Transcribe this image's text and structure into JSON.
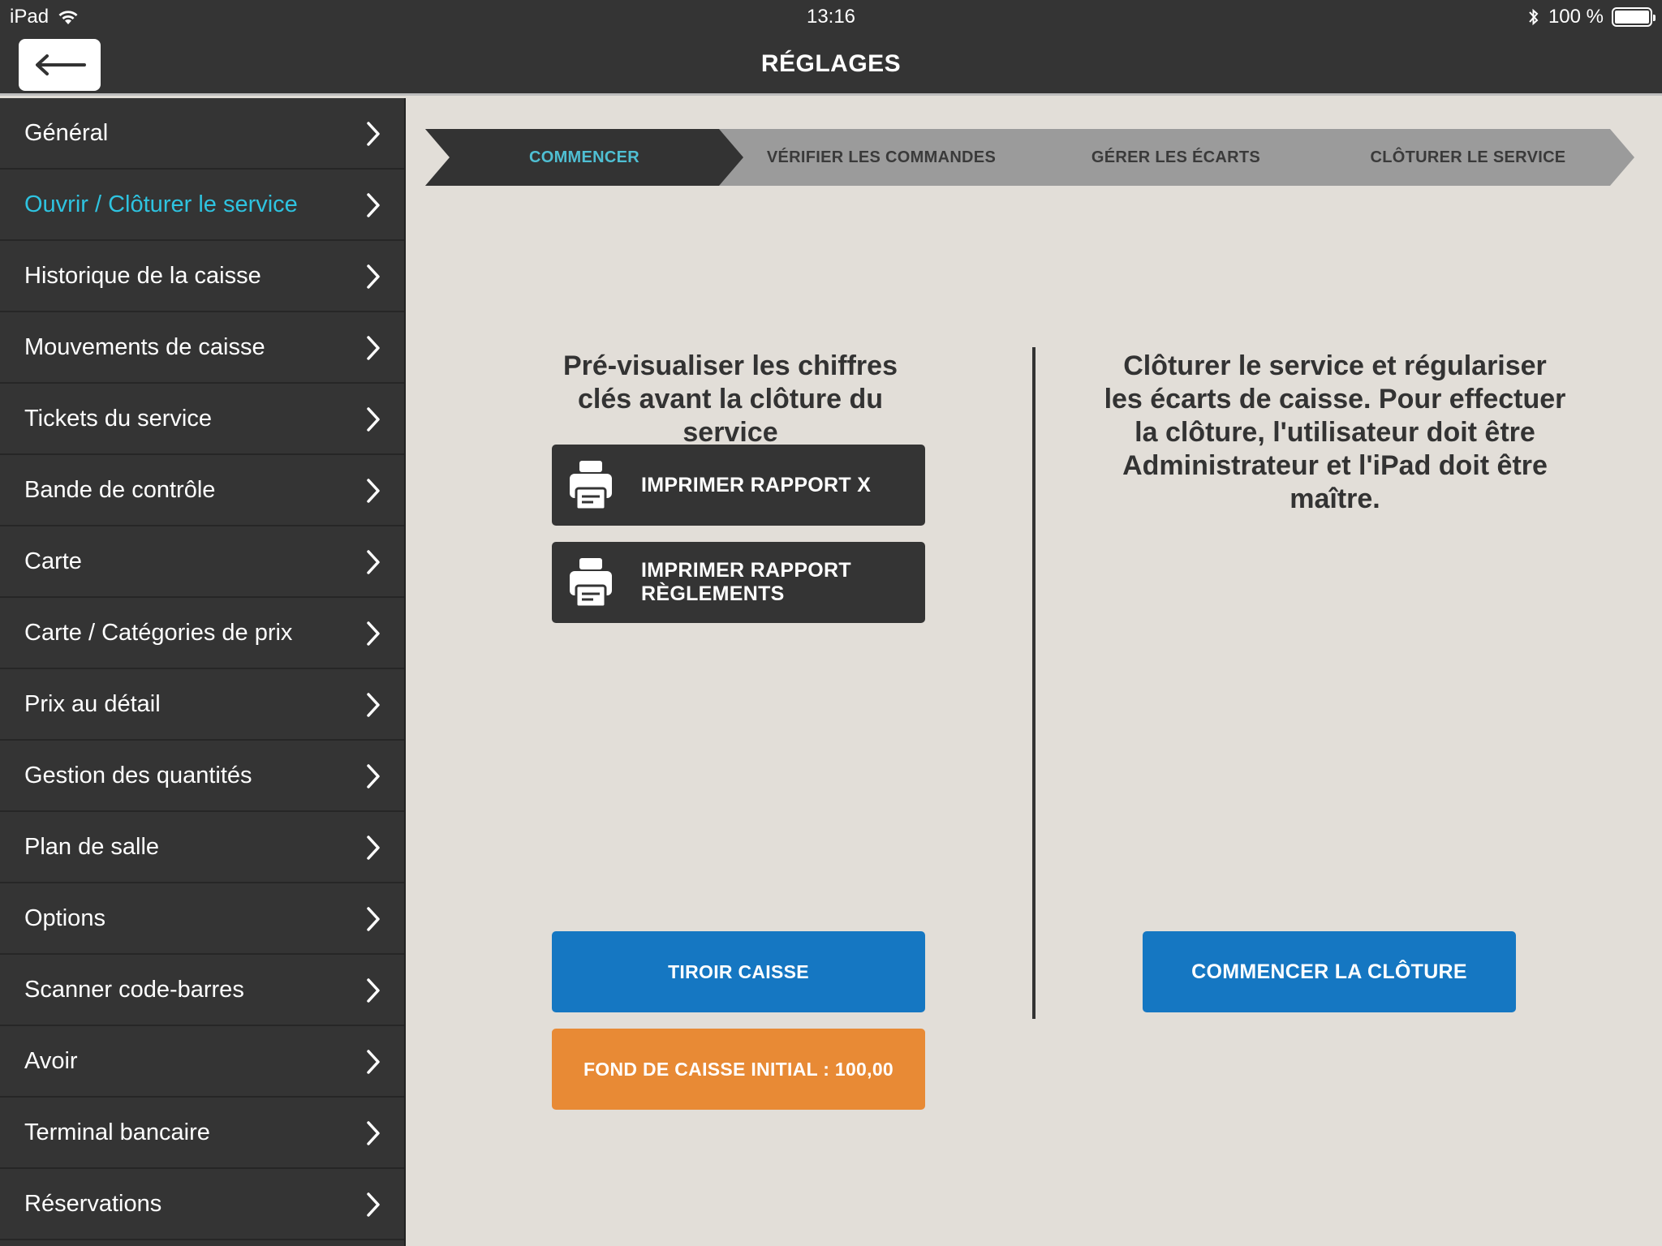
{
  "status_bar": {
    "device": "iPad",
    "time": "13:16",
    "battery": "100 %",
    "battery_level": 1.0
  },
  "nav": {
    "title": "RÉGLAGES"
  },
  "sidebar": {
    "items": [
      {
        "label": "Général"
      },
      {
        "label": "Ouvrir / Clôturer le service"
      },
      {
        "label": "Historique de la caisse"
      },
      {
        "label": "Mouvements de caisse"
      },
      {
        "label": "Tickets du service"
      },
      {
        "label": "Bande de contrôle"
      },
      {
        "label": "Carte"
      },
      {
        "label": "Carte / Catégories de prix"
      },
      {
        "label": "Prix au détail"
      },
      {
        "label": "Gestion des quantités"
      },
      {
        "label": "Plan de salle"
      },
      {
        "label": "Options"
      },
      {
        "label": "Scanner code-barres"
      },
      {
        "label": "Avoir"
      },
      {
        "label": "Terminal bancaire"
      },
      {
        "label": "Réservations"
      }
    ],
    "active_index": 1
  },
  "stepper": {
    "steps": [
      {
        "label": "COMMENCER"
      },
      {
        "label": "VÉRIFIER LES COMMANDES"
      },
      {
        "label": "GÉRER LES ÉCARTS"
      },
      {
        "label": "CLÔTURER LE SERVICE"
      }
    ],
    "active_index": 0
  },
  "left_panel": {
    "title": "Pré-visualiser les chiffres clés avant la clôture du service",
    "print_x": "IMPRIMER RAPPORT X",
    "print_payments": "IMPRIMER RAPPORT RÈGLEMENTS",
    "drawer": "TIROIR CAISSE",
    "initial_float": "FOND DE CAISSE INITIAL : 100,00"
  },
  "right_panel": {
    "title": "Clôturer le service et régulariser les écarts de caisse. Pour effectuer la clôture, l'utilisateur doit être Administrateur et l'iPad doit être maître.",
    "start_close": "COMMENCER LA CLÔTURE"
  },
  "colors": {
    "dark": "#343434",
    "accent_cyan": "#2ec3e0",
    "blue": "#1577c2",
    "orange": "#e88a35",
    "background": "#e2ded8"
  }
}
